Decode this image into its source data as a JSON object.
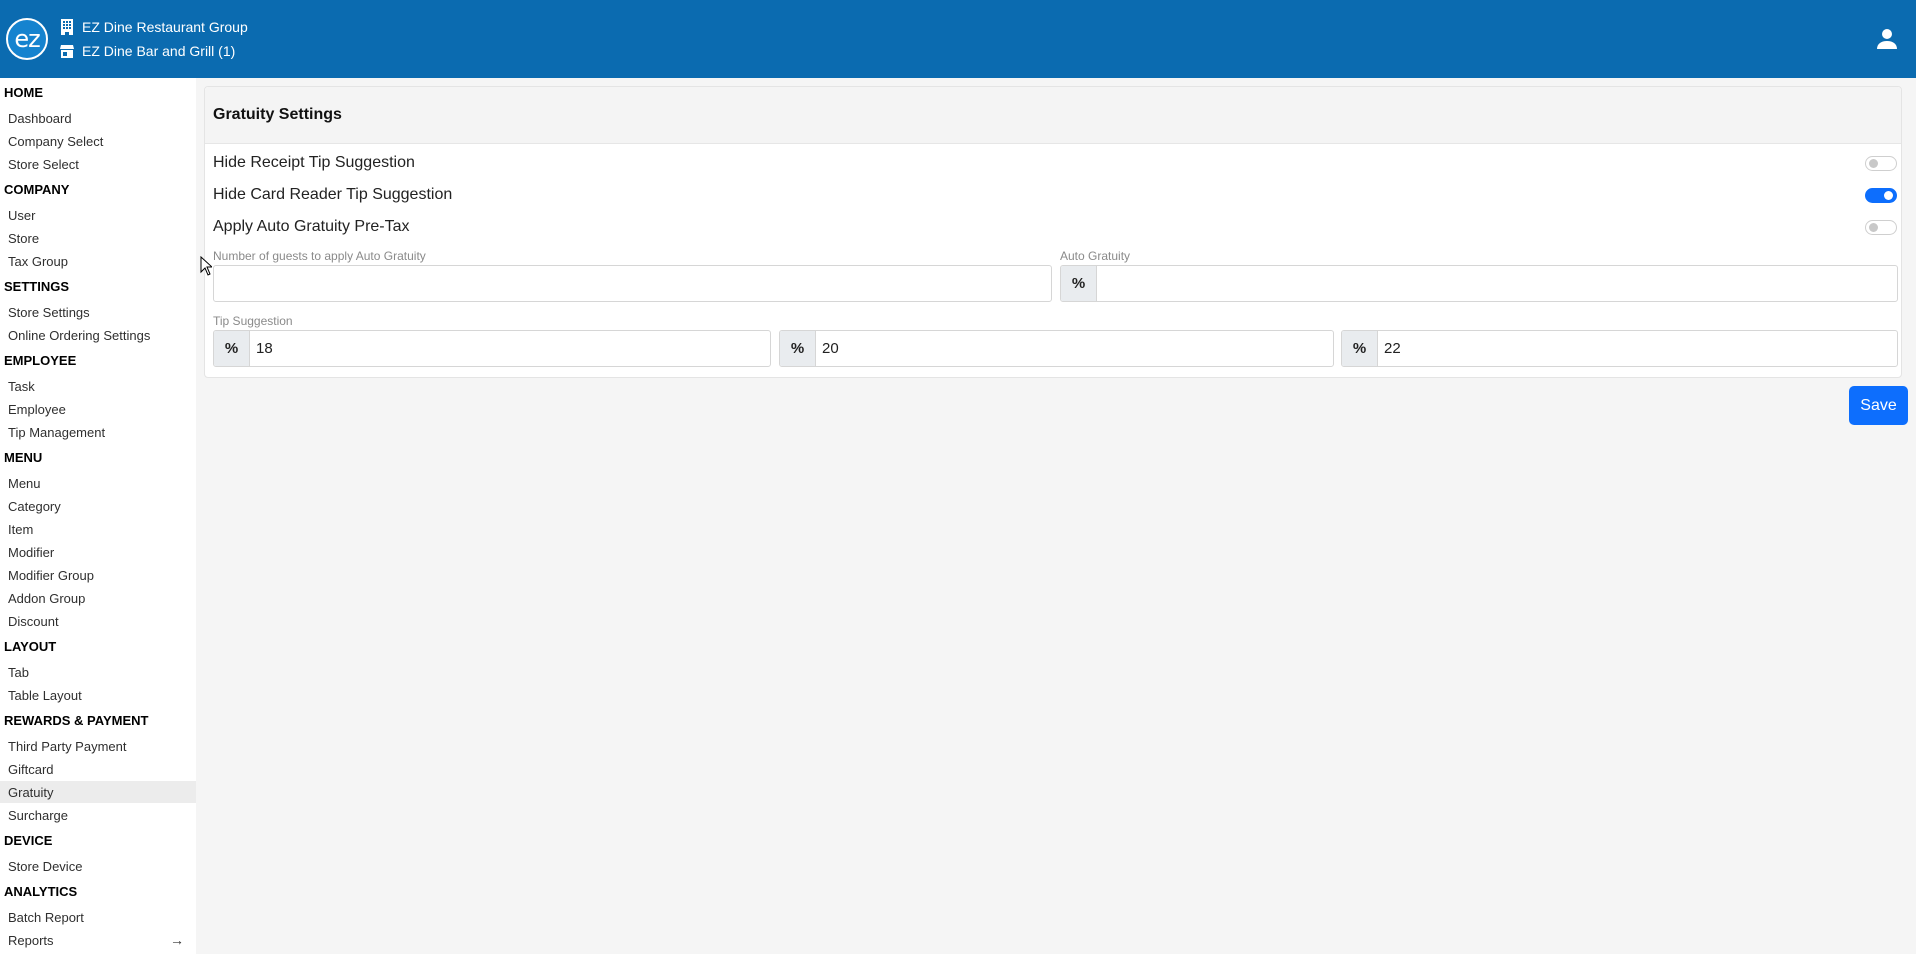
{
  "header": {
    "logo_text": "ez",
    "company": "EZ Dine Restaurant Group",
    "store": "EZ Dine Bar and Grill (1)",
    "bg_color": "#0b6bb0"
  },
  "sidebar": {
    "sections": [
      {
        "title": "HOME",
        "items": [
          "Dashboard",
          "Company Select",
          "Store Select"
        ]
      },
      {
        "title": "COMPANY",
        "items": [
          "User",
          "Store",
          "Tax Group"
        ]
      },
      {
        "title": "SETTINGS",
        "items": [
          "Store Settings",
          "Online Ordering Settings"
        ]
      },
      {
        "title": "EMPLOYEE",
        "items": [
          "Task",
          "Employee",
          "Tip Management"
        ]
      },
      {
        "title": "MENU",
        "items": [
          "Menu",
          "Category",
          "Item",
          "Modifier",
          "Modifier Group",
          "Addon Group",
          "Discount"
        ]
      },
      {
        "title": "LAYOUT",
        "items": [
          "Tab",
          "Table Layout"
        ]
      },
      {
        "title": "REWARDS & PAYMENT",
        "items": [
          "Third Party Payment",
          "Giftcard",
          "Gratuity",
          "Surcharge"
        ]
      },
      {
        "title": "DEVICE",
        "items": [
          "Store Device"
        ]
      },
      {
        "title": "ANALYTICS",
        "items": [
          "Batch Report",
          "Reports"
        ]
      }
    ],
    "active_item": "Gratuity",
    "reports_arrow": "→"
  },
  "gratuity": {
    "title": "Gratuity Settings",
    "toggles": [
      {
        "label": "Hide Receipt Tip Suggestion",
        "on": false
      },
      {
        "label": "Hide Card Reader Tip Suggestion",
        "on": true
      },
      {
        "label": "Apply Auto Gratuity Pre-Tax",
        "on": false
      }
    ],
    "guests_label": "Number of guests to apply Auto Gratuity",
    "guests_value": "",
    "auto_label": "Auto Gratuity",
    "auto_value": "",
    "percent_symbol": "%",
    "tip_label": "Tip Suggestion",
    "tips": [
      "18",
      "20",
      "22"
    ],
    "save_label": "Save",
    "accent_color": "#0d6efd"
  }
}
